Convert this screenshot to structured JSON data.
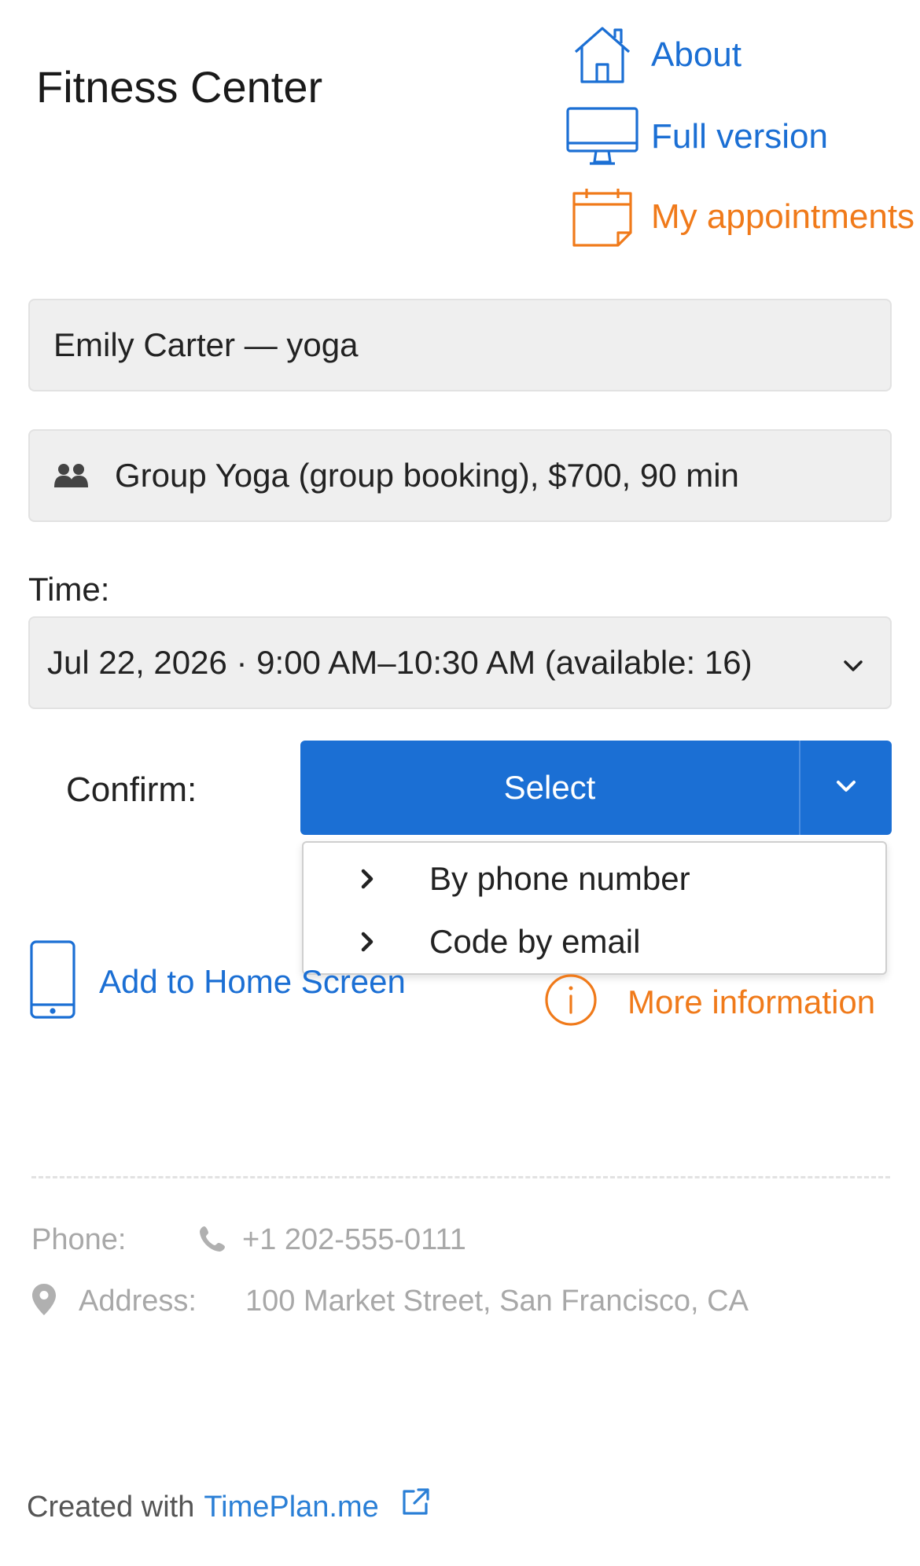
{
  "header": {
    "title": "Fitness Center",
    "nav": {
      "about": "About",
      "full_version": "Full version",
      "my_appointments": "My appointments"
    }
  },
  "booking": {
    "provider": "Emily Carter — yoga",
    "service": "Group Yoga (group booking), $700, 90 min",
    "time_label": "Time:",
    "time_value": "Jul 22, 2026 · 9:00 AM–10:30 AM (available: 16)",
    "confirm_label": "Confirm:",
    "select_label": "Select",
    "confirm_options": [
      "By phone number",
      "Code by email"
    ]
  },
  "links": {
    "add_home": "Add to Home Screen",
    "more_info": "More information"
  },
  "contact": {
    "phone_label": "Phone:",
    "phone_value": "+1 202-555-0111",
    "address_label": "Address:",
    "address_value": "100 Market Street, San Francisco, CA"
  },
  "footer": {
    "created_with": "Created with",
    "brand": "TimePlan.me"
  },
  "colors": {
    "blue": "#1b6fd4",
    "orange": "#f07a1a",
    "muted": "#a8a8a8"
  },
  "icons": {
    "about": "house-icon",
    "full_version": "monitor-icon",
    "my_appointments": "calendar-icon",
    "service": "group-users-icon",
    "time": "chevron-down-icon",
    "select_caret": "chevron-down-icon",
    "dropdown_items": "chevron-right-icon",
    "add_home": "smartphone-icon",
    "more_info": "info-circle-icon",
    "phone": "phone-icon",
    "address": "map-pin-icon",
    "footer": "external-link-icon"
  }
}
